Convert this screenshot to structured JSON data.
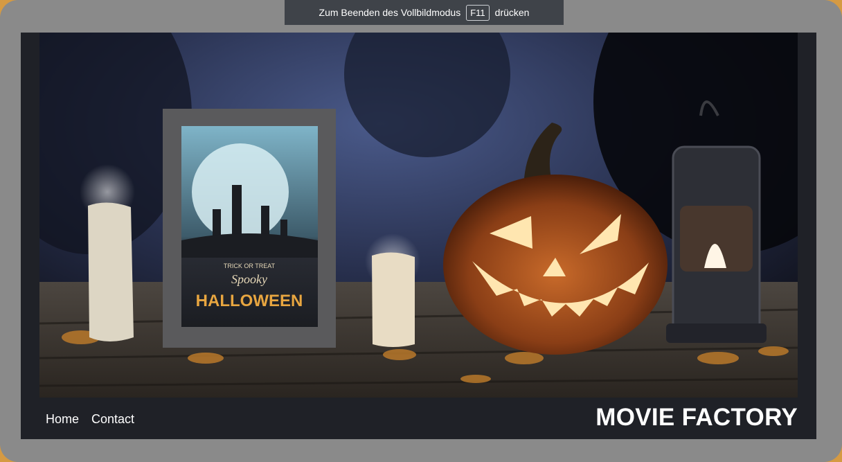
{
  "fullscreen_notice": {
    "before": "Zum Beenden des Vollbildmodus",
    "key": "F11",
    "after": "drücken"
  },
  "hero": {
    "poster_line1": "TRICK OR TREAT",
    "poster_line2": "Spooky",
    "poster_line3": "HALLOWEEN"
  },
  "nav": {
    "home": "Home",
    "contact": "Contact"
  },
  "brand": {
    "title": "MOVIE FACTORY"
  },
  "colors": {
    "site_bg": "#1f2127",
    "frame_gray": "#8a8a8a",
    "outer_orange": "#d59a43",
    "banner_bg": "#3f4349"
  }
}
